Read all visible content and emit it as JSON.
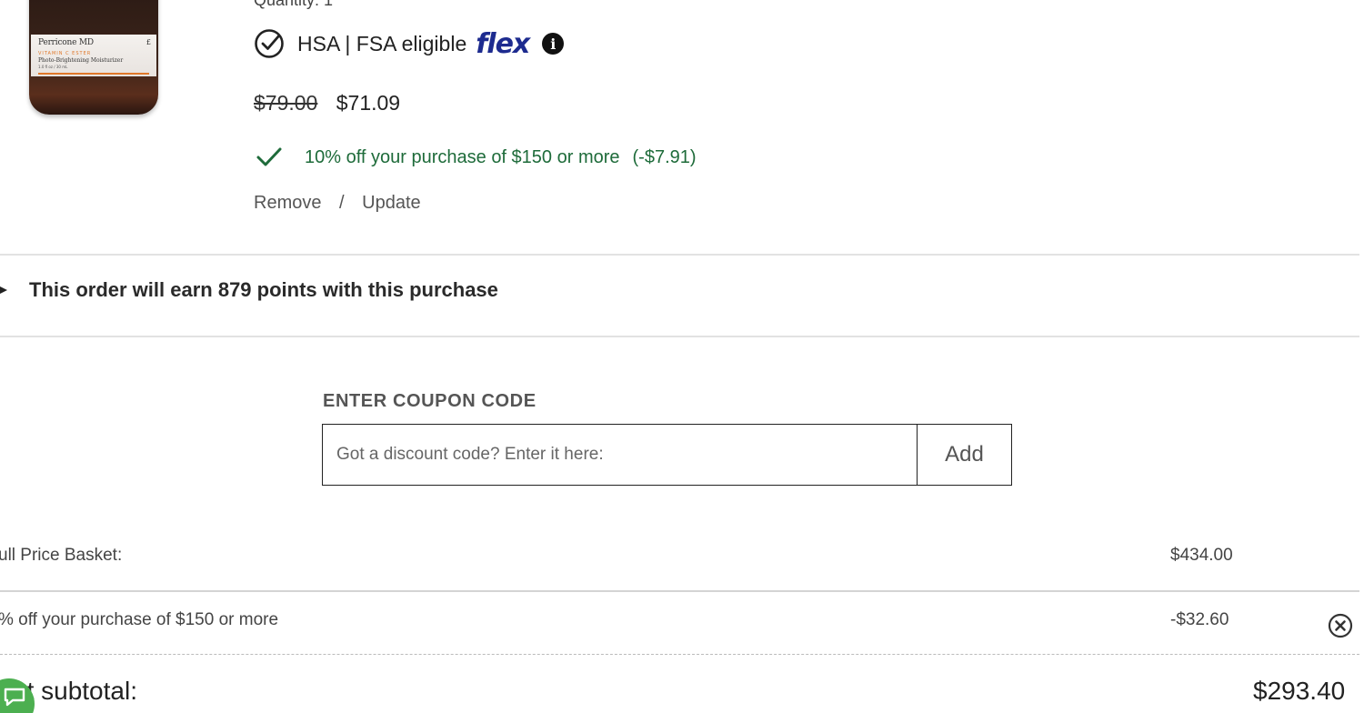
{
  "product": {
    "image_brand": "Perricone MD",
    "image_badge": "£",
    "image_line1": "VITAMIN C ESTER",
    "image_line2": "Photo-Brightening Moisturizer",
    "image_line3": "1.0 fl oz / 30 mL",
    "quantity_partial": "Quantity: 1",
    "hsa_text": "HSA | FSA eligible",
    "flex_logo": "flex",
    "info_icon_glyph": "i",
    "old_price": "$79.00",
    "new_price": "$71.09",
    "promo_text": "10% off your purchase of $150 or more",
    "promo_amount": "(-$7.91)",
    "remove_label": "Remove",
    "actions_separator": "/",
    "update_label": "Update"
  },
  "points": {
    "text": "This order will earn 879 points with this purchase"
  },
  "coupon": {
    "label": "ENTER COUPON CODE",
    "placeholder": "Got a discount code? Enter it here:",
    "add_label": "Add"
  },
  "summary": {
    "full_price_label": "ull Price Basket:",
    "full_price_value": "$434.00",
    "discount_label": "% off your purchase of $150 or more",
    "discount_value": "-$32.60",
    "subtotal_label": "ket subtotal:",
    "subtotal_value": "$293.40"
  },
  "colors": {
    "promo_green": "#1e6b3a",
    "flex_blue": "#1d2b8f",
    "chat_green": "#4caf50"
  },
  "icons": {
    "hsa": "check-circle-icon",
    "info": "info-icon",
    "promo": "check-icon",
    "caret": "caret-right-icon",
    "remove": "close-circle-icon",
    "chat": "chat-icon"
  }
}
